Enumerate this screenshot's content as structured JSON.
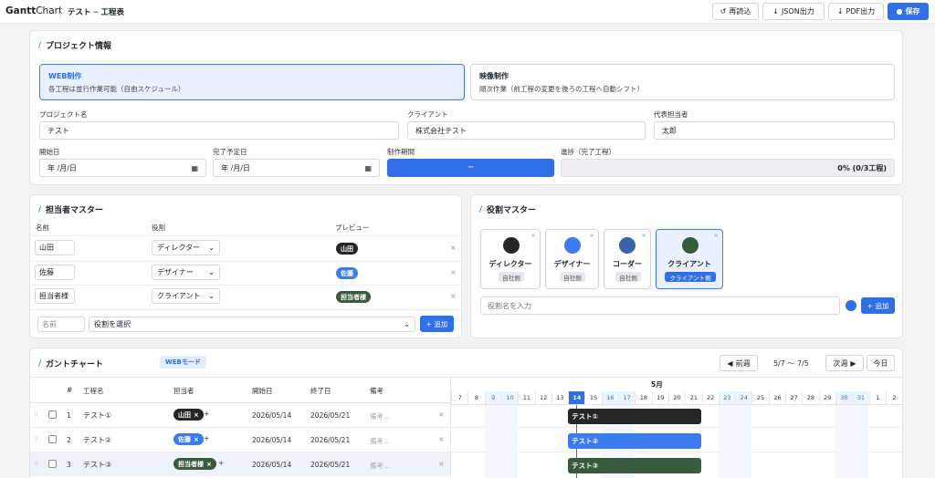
{
  "app": {
    "logo_bold": "Gantt",
    "logo_light": "Chart",
    "doc_title": "テスト ─ 工程表"
  },
  "toolbar": {
    "reload": "再読込",
    "json": "JSON出力",
    "pdf": "PDF出力",
    "save": "保存"
  },
  "project": {
    "section_title": "プロジェクト情報",
    "modes": [
      {
        "title": "WEB制作",
        "desc": "各工程は並行作業可能（自由スケジュール）"
      },
      {
        "title": "映像制作",
        "desc": "順次作業（前工程の変更を後ろの工程へ自動シフト）"
      }
    ],
    "labels": {
      "name": "プロジェクト名",
      "client": "クライアント",
      "rep": "代表担当者",
      "start": "開始日",
      "end": "完了予定日",
      "period": "制作期間",
      "progress": "進捗（完了工程）"
    },
    "values": {
      "name": "テスト",
      "client": "株式会社テスト",
      "rep": "太郎",
      "start": "年 /月/日",
      "end": "年 /月/日",
      "period": "─",
      "progress": "0% (0/3工程)"
    }
  },
  "assignees": {
    "section_title": "担当者マスター",
    "headers": {
      "name": "名前",
      "role": "役割",
      "preview": "プレビュー"
    },
    "rows": [
      {
        "name": "山田",
        "role": "ディレクター",
        "preview": "山田"
      },
      {
        "name": "佐藤",
        "role": "デザイナー",
        "preview": "佐藤"
      },
      {
        "name": "担当者様",
        "role": "クライアント",
        "preview": "担当者様"
      }
    ],
    "new_name_placeholder": "名前",
    "new_role_placeholder": "役割を選択",
    "add": "+ 追加"
  },
  "roles": {
    "section_title": "役割マスター",
    "items": [
      {
        "name": "ディレクター",
        "badge": "自社側",
        "color": "#262626"
      },
      {
        "name": "デザイナー",
        "badge": "自社側",
        "color": "#3b7cf0"
      },
      {
        "name": "コーダー",
        "badge": "自社側",
        "color": "#3d62a6"
      },
      {
        "name": "クライアント",
        "badge": "クライアント側",
        "color": "#3a5a3d"
      }
    ],
    "input_placeholder": "役割名を入力",
    "add": "+ 追加"
  },
  "gantt": {
    "section_title": "ガントチャート",
    "mode_badge": "WEBモード",
    "prev": "前週",
    "range": "5/7 〜 7/5",
    "next": "次週",
    "today": "今日",
    "columns": {
      "num": "#",
      "task": "工程名",
      "assignee": "担当者",
      "start": "開始日",
      "end": "終了日",
      "note": "備考"
    },
    "month": "5月",
    "days": [
      "7",
      "8",
      "9",
      "10",
      "11",
      "12",
      "13",
      "14",
      "15",
      "16",
      "17",
      "18",
      "19",
      "20",
      "21",
      "22",
      "23",
      "24",
      "25",
      "26",
      "27",
      "28",
      "29",
      "30",
      "31",
      "1",
      "2"
    ],
    "weekend_days": [
      "9",
      "10",
      "16",
      "17",
      "23",
      "24",
      "30",
      "31"
    ],
    "today_day": "14",
    "tasks": [
      {
        "num": "1",
        "name": "テスト①",
        "assignee": "山田",
        "start": "2026/05/14",
        "end": "2026/05/21",
        "note": "備考...",
        "color": "#262626"
      },
      {
        "num": "2",
        "name": "テスト②",
        "assignee": "佐藤",
        "start": "2026/05/14",
        "end": "2026/05/21",
        "note": "備考...",
        "color": "#3b7cf0"
      },
      {
        "num": "3",
        "name": "テスト③",
        "assignee": "担当者様",
        "start": "2026/05/14",
        "end": "2026/05/21",
        "note": "備考...",
        "color": "#3a5a3d"
      }
    ]
  },
  "colors": {
    "accent": "#2f6fe8"
  }
}
